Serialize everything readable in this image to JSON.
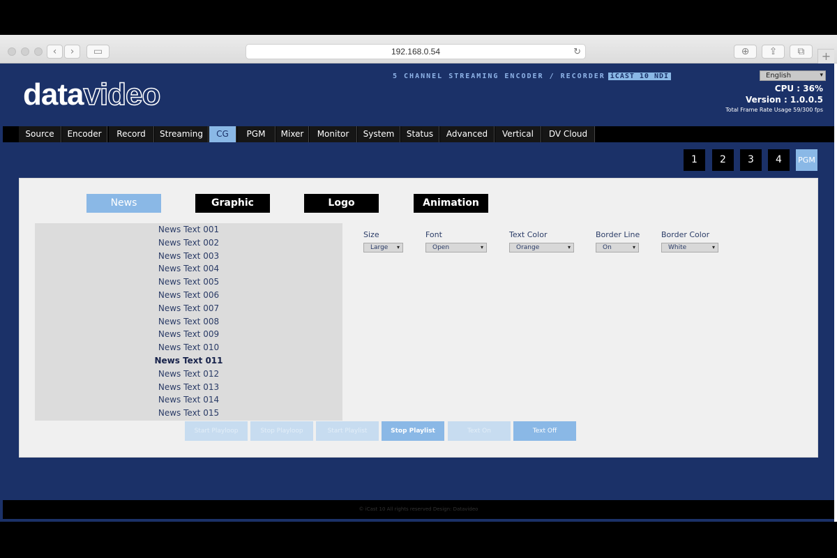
{
  "browser": {
    "address": "192.168.0.54"
  },
  "header": {
    "logo_a": "data",
    "logo_b": "video",
    "product": "5 CHANNEL STREAMING ENCODER / RECORDER",
    "product_tag": "iCAST 10 NDI",
    "language": "English",
    "cpu": "CPU  : 36%",
    "version": "Version : 1.0.0.5",
    "frame_rate": "Total Frame Rate Usage 59/300 fps"
  },
  "tabs": [
    "Source",
    "Encoder",
    "Record",
    "Streaming",
    "CG",
    "PGM",
    "Mixer",
    "Monitor",
    "System",
    "Status",
    "Advanced",
    "Vertical",
    "DV Cloud"
  ],
  "active_tab": "CG",
  "channels": [
    "1",
    "2",
    "3",
    "4",
    "PGM"
  ],
  "active_channel": "PGM",
  "cg_tabs": [
    "News",
    "Graphic",
    "Logo",
    "Animation"
  ],
  "active_cg_tab": "News",
  "news_list": [
    "News Text 001",
    "News Text 002",
    "News Text 003",
    "News Text 004",
    "News Text 005",
    "News Text 006",
    "News Text 007",
    "News Text 008",
    "News Text 009",
    "News Text 010",
    "News Text 011",
    "News Text 012",
    "News Text 013",
    "News Text 014",
    "News Text 015"
  ],
  "selected_news": "News Text 011",
  "controls": {
    "size": {
      "label": "Size",
      "value": "Large"
    },
    "font": {
      "label": "Font",
      "value": "Open"
    },
    "text_color": {
      "label": "Text Color",
      "value": "Orange"
    },
    "border_line": {
      "label": "Border Line",
      "value": "On"
    },
    "border_color": {
      "label": "Border Color",
      "value": "White"
    }
  },
  "actions": {
    "start_playloop": "Start Playloop",
    "stop_playloop": "Stop Playloop",
    "start_playlist": "Start Playlist",
    "stop_playlist": "Stop Playlist",
    "text_on": "Text On",
    "text_off": "Text Off"
  },
  "footer": "© iCast 10 All rights reserved Design: Datavideo",
  "colors": {
    "app_bg": "#1b3168",
    "accent": "#8ab8e6",
    "panel": "#f0f0f0"
  }
}
